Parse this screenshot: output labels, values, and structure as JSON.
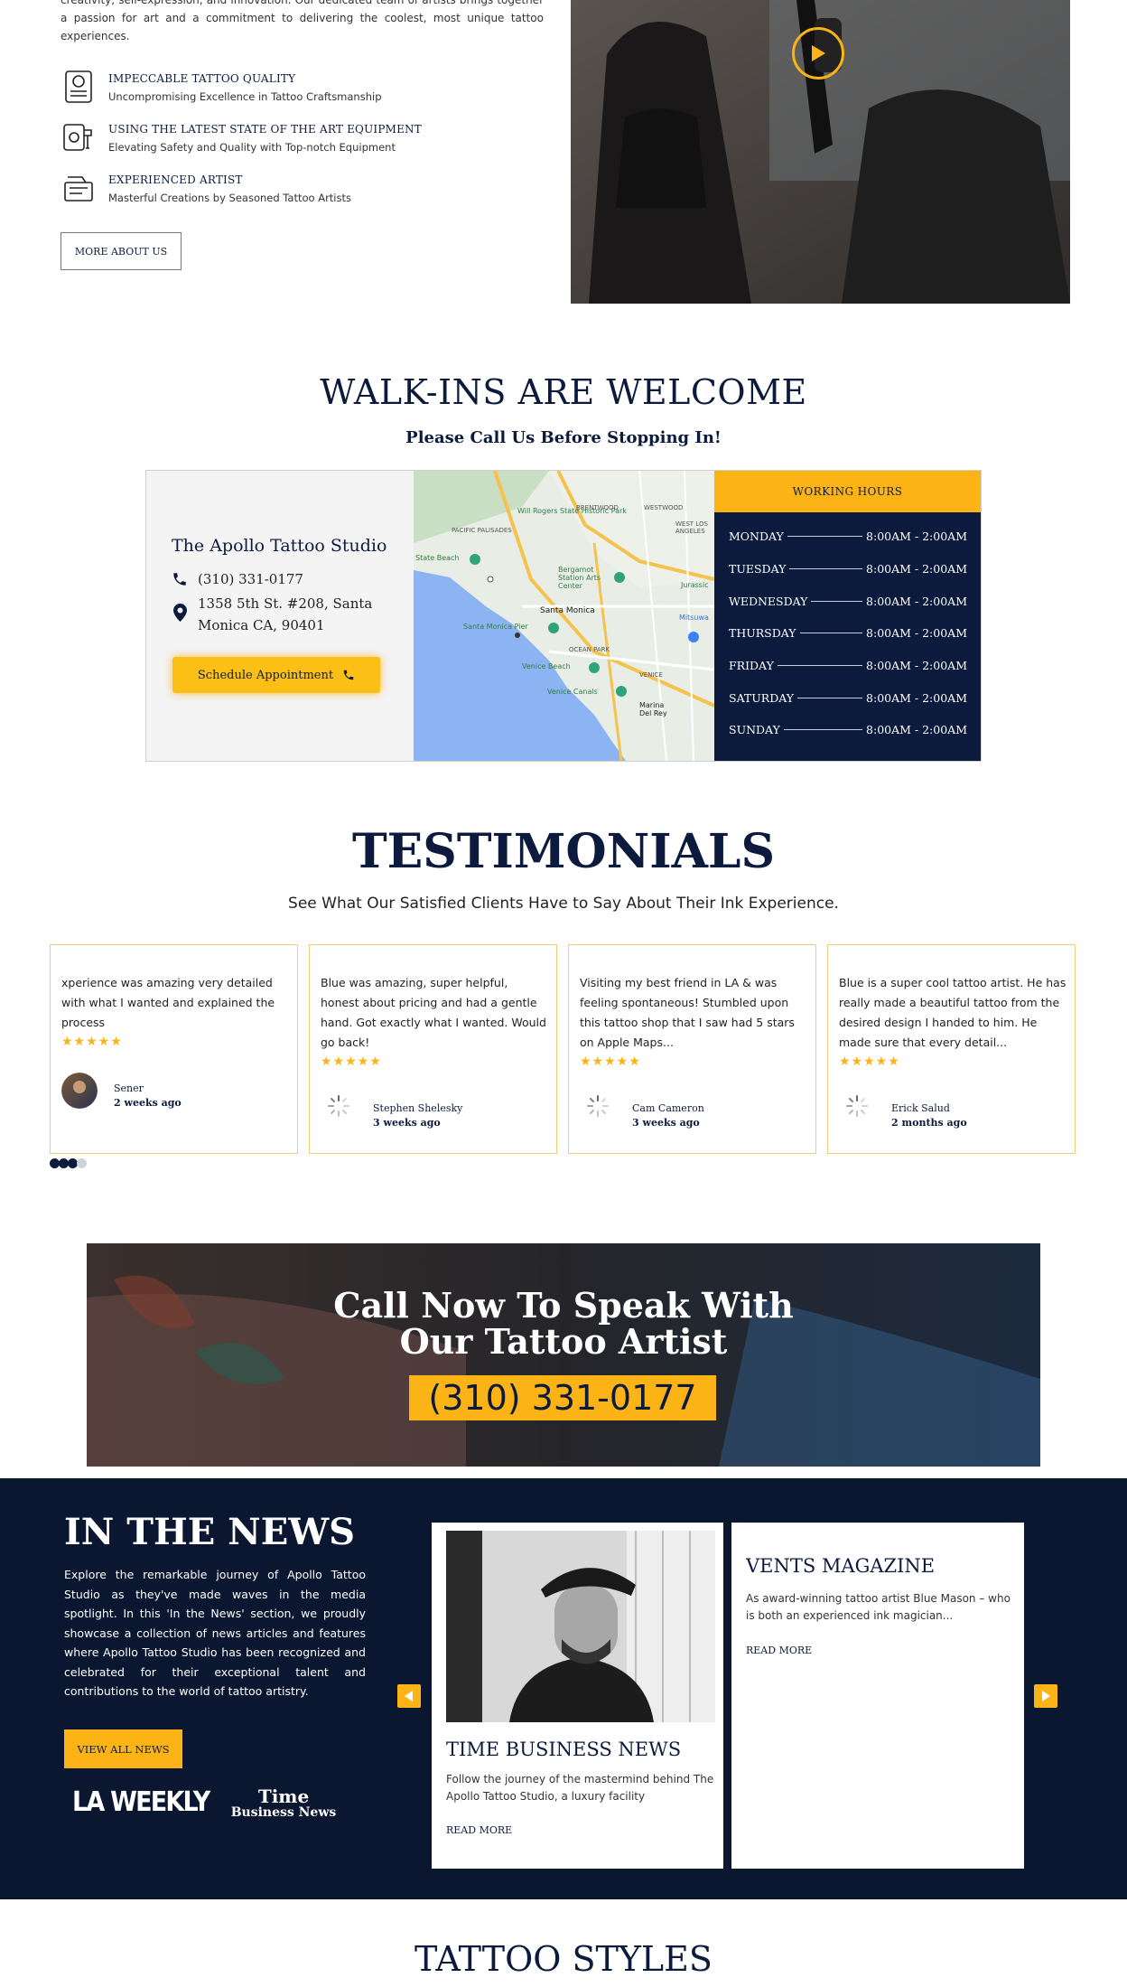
{
  "about": {
    "text": "creativity, self-expression, and innovation. Our dedicated team of artists brings together a passion for art and a commitment to delivering the coolest, most unique tattoo experiences.",
    "features": [
      {
        "title": "IMPECCABLE TATTOO QUALITY",
        "subtitle": "Uncompromising Excellence in Tattoo Craftsmanship"
      },
      {
        "title": "USING THE LATEST STATE OF THE ART EQUIPMENT",
        "subtitle": "Elevating Safety and Quality with Top-notch Equipment"
      },
      {
        "title": "EXPERIENCED ARTIST",
        "subtitle": "Masterful Creations by Seasoned Tattoo Artists"
      }
    ],
    "button": "MORE ABOUT US"
  },
  "walkins": {
    "heading": "WALK-INS ARE WELCOME",
    "subheading": "Please Call Us Before Stopping In!",
    "studio_name": "The Apollo Tattoo Studio",
    "phone": "(310) 331-0177",
    "address_line1": "1358 5th St. #208, Santa",
    "address_line2": "Monica CA, 90401",
    "schedule_button": "Schedule Appointment",
    "map_labels": [
      "Will Rogers State Historic Park",
      "BRENTWOOD",
      "WESTWOOD",
      "PACIFIC PALISADES",
      "State Beach",
      "Bergamot Station Arts Center",
      "Santa Monica",
      "Santa Monica Pier",
      "OCEAN PARK",
      "Venice Beach",
      "Venice Canals",
      "Marina Del Rey",
      "Jurassic",
      "Mitsuwa",
      "WEST LOS ANGELES",
      "VENICE"
    ],
    "hours_title": "WORKING HOURS",
    "hours": [
      {
        "day": "MONDAY",
        "time": "8:00AM - 2:00AM"
      },
      {
        "day": "TUESDAY",
        "time": "8:00AM - 2:00AM"
      },
      {
        "day": "WEDNESDAY",
        "time": "8:00AM - 2:00AM"
      },
      {
        "day": "THURSDAY",
        "time": "8:00AM - 2:00AM"
      },
      {
        "day": "FRIDAY",
        "time": "8:00AM - 2:00AM"
      },
      {
        "day": "SATURDAY",
        "time": "8:00AM - 2:00AM"
      },
      {
        "day": "SUNDAY",
        "time": "8:00AM - 2:00AM"
      }
    ]
  },
  "testimonials": {
    "heading": "TESTIMONIALS",
    "subheading": "See What Our Satisfied Clients Have to Say About Their Ink Experience.",
    "stars": "★★★★★",
    "items": [
      {
        "text": "xperience was amazing very detailed with what I wanted and explained the process",
        "name": "Sener",
        "ago": "2 weeks ago"
      },
      {
        "text": "Blue was amazing, super helpful, honest about pricing and had a gentle hand. Got exactly what I wanted. Would go back!",
        "name": "Stephen Shelesky",
        "ago": "3 weeks ago"
      },
      {
        "text": "Visiting my best friend in LA & was feeling spontaneous! Stumbled upon this tattoo shop that I saw had 5 stars on Apple Maps...",
        "name": "Cam Cameron",
        "ago": "3 weeks ago"
      },
      {
        "text": "Blue is a super cool tattoo artist. He has really made a beautiful tattoo from the desired design I handed to him. He made sure that every detail...",
        "name": "Erick Salud",
        "ago": "2 months ago"
      }
    ]
  },
  "cta": {
    "line1": "Call Now To Speak With",
    "line2": "Our Tattoo Artist",
    "phone": "(310) 331-0177"
  },
  "news": {
    "heading": "IN THE NEWS",
    "body": "Explore the remarkable journey of Apollo Tattoo Studio as they've made waves in the media spotlight. In this 'In the News' section, we proudly showcase a collection of news articles and features where Apollo Tattoo Studio has been recognized and celebrated for their exceptional talent and contributions to the world of tattoo artistry.",
    "button": "VIEW ALL NEWS",
    "logo_la": "LA WEEKLY",
    "logo_time_1": "Time",
    "logo_time_2": "Business News",
    "cards": [
      {
        "title": "TIME BUSINESS NEWS",
        "excerpt": "Follow the journey of the mastermind behind The Apollo Tattoo Studio, a luxury facility",
        "read_more": "READ MORE"
      },
      {
        "title": "VENTS MAGAZINE",
        "excerpt": "As award-winning tattoo artist Blue Mason – who is both an experienced ink magician...",
        "read_more": "READ MORE"
      }
    ]
  },
  "styles": {
    "heading": "TATTOO STYLES"
  },
  "colors": {
    "navy": "#0c1b3d",
    "accent": "#fbb316",
    "card_border": "#f7c97a"
  }
}
